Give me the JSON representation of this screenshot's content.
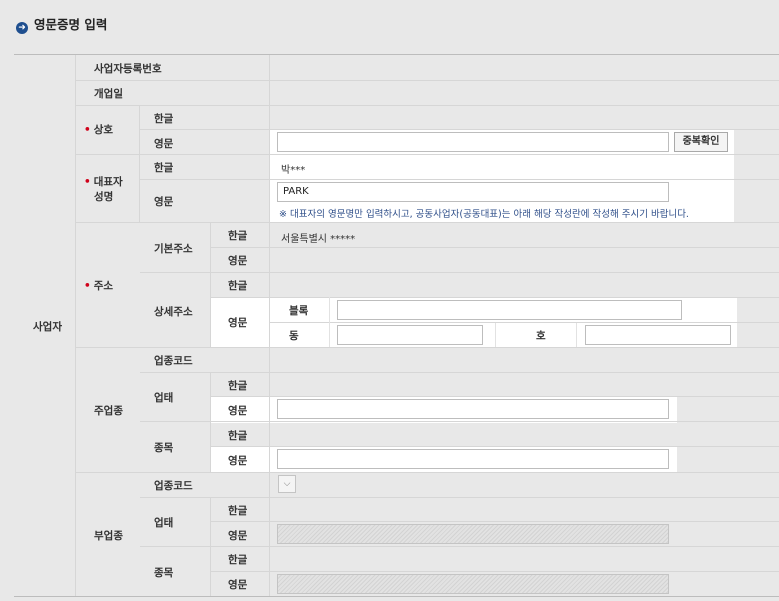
{
  "title": "영문증명 입력",
  "section": "사업자",
  "rows": {
    "bizno": "사업자등록번호",
    "open_date": "개업일",
    "company": "상호",
    "rep_name_1": "대표자",
    "rep_name_2": "성명",
    "address": "주소",
    "basic_addr": "기본주소",
    "detail_addr": "상세주소",
    "main_biz": "주업종",
    "sub_biz": "부업종",
    "biz_code": "업종코드",
    "biz_type": "업태",
    "biz_item": "종목"
  },
  "lang": {
    "ko": "한글",
    "en": "영문"
  },
  "detail": {
    "block": "블록",
    "dong": "동",
    "ho": "호"
  },
  "values": {
    "rep_name_ko": "박***",
    "rep_name_en": "PARK",
    "basic_addr_ko": "서울특별시      *****"
  },
  "buttons": {
    "dup_check": "중복확인"
  },
  "note": "※ 대표자의 영문명만 입력하시고, 공동사업자(공동대표)는 아래 해당 작성란에 작성해 주시기 바랍니다.",
  "colors": {
    "accent": "#1f4f8f",
    "required": "#d0021b",
    "note": "#2f4f8a"
  }
}
